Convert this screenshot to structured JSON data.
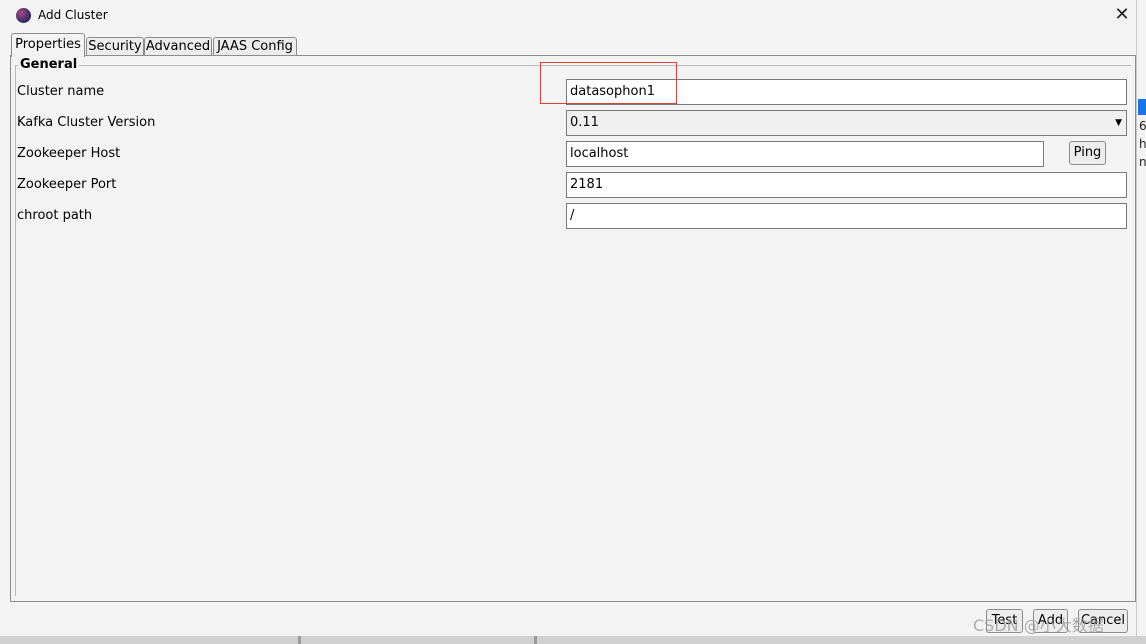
{
  "window": {
    "title": "Add Cluster",
    "close_glyph": "✕"
  },
  "tabs": [
    {
      "label": "Properties",
      "active": true
    },
    {
      "label": "Security"
    },
    {
      "label": "Advanced"
    },
    {
      "label": "JAAS Config"
    }
  ],
  "general": {
    "group_title": "General",
    "cluster_name": {
      "label": "Cluster name",
      "value": "datasophon1"
    },
    "kafka_version": {
      "label": "Kafka Cluster Version",
      "value": "0.11"
    },
    "zookeeper_host": {
      "label": "Zookeeper Host",
      "value": "localhost"
    },
    "zookeeper_port": {
      "label": "Zookeeper Port",
      "value": "2181"
    },
    "chroot_path": {
      "label": "chroot path",
      "value": "/"
    },
    "ping_label": "Ping"
  },
  "footer": {
    "test_label": "Test",
    "add_label": "Add",
    "cancel_label": "Cancel"
  },
  "background": {
    "frag1": "6",
    "frag2": "h",
    "frag3": "n"
  },
  "watermark": "CSDN @小大数据",
  "colors": {
    "highlight": "#e0403c",
    "accent": "#1a73e8"
  },
  "icons": {
    "app": "kafka-tool-icon",
    "close": "close-icon",
    "dropdown": "chevron-down-icon"
  }
}
